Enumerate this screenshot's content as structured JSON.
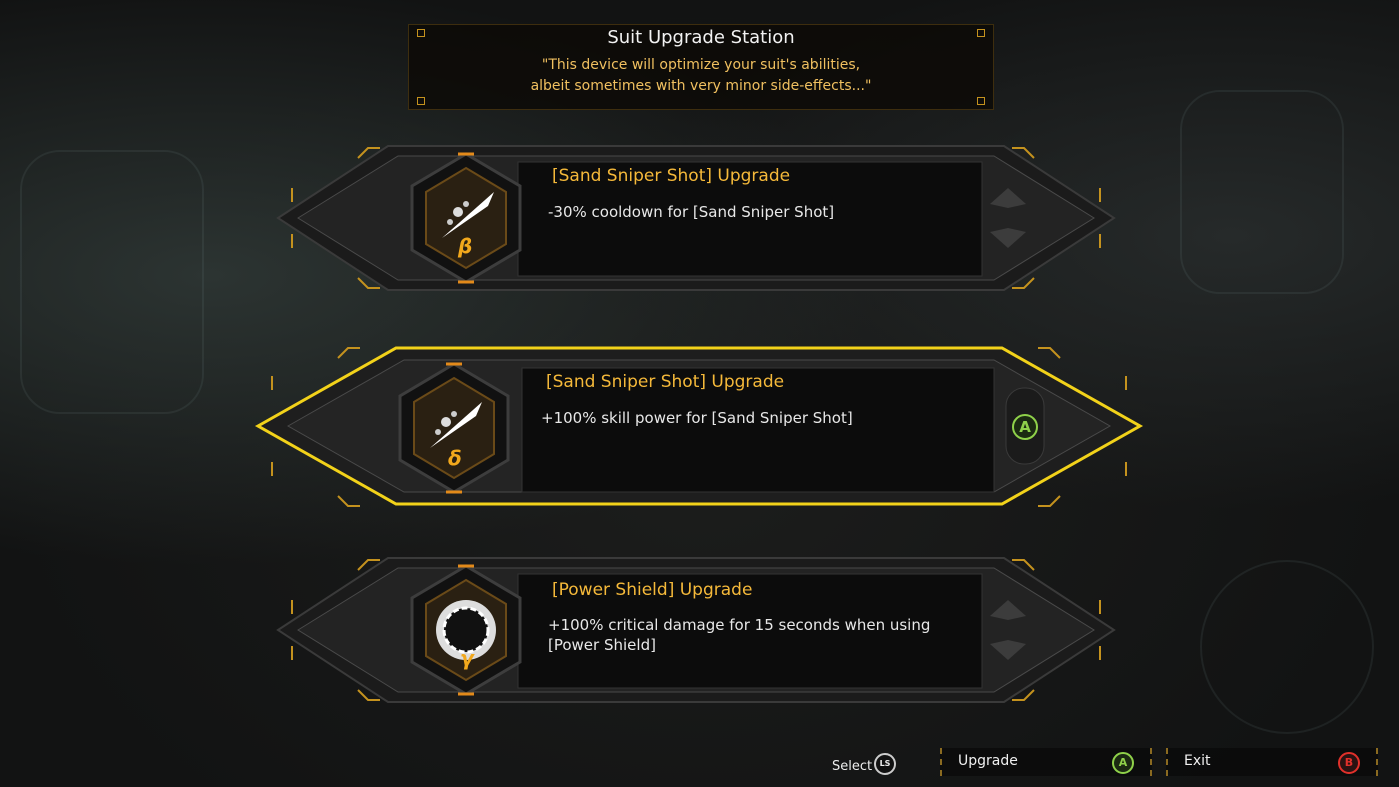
{
  "header": {
    "title": "Suit Upgrade Station",
    "quote_line1": "\"This device will optimize your suit's abilities,",
    "quote_line2": "albeit sometimes with very minor side-effects...\""
  },
  "options": [
    {
      "title": "[Sand Sniper Shot] Upgrade",
      "description": "-30% cooldown for [Sand Sniper Shot]",
      "tier": "β",
      "icon": "sand-sniper-shot-icon",
      "selected": false
    },
    {
      "title": "[Sand Sniper Shot] Upgrade",
      "description": "+100% skill power for [Sand Sniper Shot]",
      "tier": "δ",
      "icon": "sand-sniper-shot-icon",
      "selected": true,
      "confirm_button": "A"
    },
    {
      "title": "[Power Shield] Upgrade",
      "description": "+100% critical damage for 15 seconds when using [Power Shield]",
      "tier": "γ",
      "icon": "power-shield-icon",
      "selected": false
    }
  ],
  "controls": {
    "select_label": "Select",
    "select_button": "LS",
    "upgrade_label": "Upgrade",
    "upgrade_button": "A",
    "exit_label": "Exit",
    "exit_button": "B"
  },
  "colors": {
    "accent_gold": "#f5b93a",
    "selected_border": "#f2d21a",
    "button_a_green": "#8fd14a",
    "button_b_red": "#e0302a"
  }
}
